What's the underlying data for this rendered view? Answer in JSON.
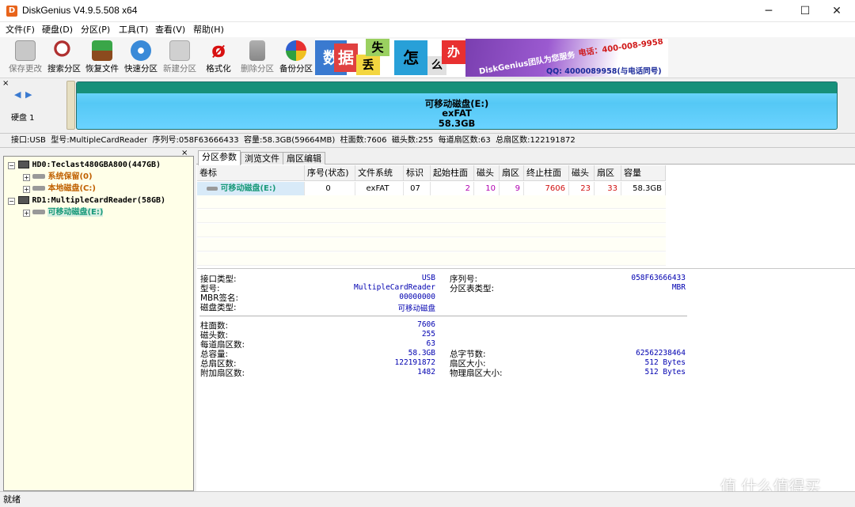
{
  "window": {
    "title": "DiskGenius V4.9.5.508 x64",
    "icon_letter": "D",
    "minimize": "─",
    "maximize": "☐",
    "close": "✕"
  },
  "menu": [
    "文件(F)",
    "硬盘(D)",
    "分区(P)",
    "工具(T)",
    "查看(V)",
    "帮助(H)"
  ],
  "toolbar": [
    {
      "label": "保存更改",
      "icon": "save-icon",
      "enabled": false
    },
    {
      "label": "搜索分区",
      "icon": "search-partition-icon",
      "enabled": true
    },
    {
      "label": "恢复文件",
      "icon": "recover-files-icon",
      "enabled": true
    },
    {
      "label": "快速分区",
      "icon": "quick-partition-icon",
      "enabled": true
    },
    {
      "label": "新建分区",
      "icon": "new-partition-icon",
      "enabled": false
    },
    {
      "label": "格式化",
      "icon": "format-icon",
      "enabled": true
    },
    {
      "label": "删除分区",
      "icon": "delete-partition-icon",
      "enabled": false
    },
    {
      "label": "备份分区",
      "icon": "backup-partition-icon",
      "enabled": true
    }
  ],
  "banner": {
    "chars": [
      "数",
      "据",
      "丢",
      "失",
      "怎",
      "么",
      "办"
    ],
    "slogan": "DiskGenius团队为您服务",
    "phone": "电话：400-008-9958",
    "qq": "QQ: 4000089958(与电话同号)"
  },
  "disk_map": {
    "nav_left": "◀",
    "nav_right": "▶",
    "disk_label": "硬盘 1",
    "partition_name": "可移动磁盘(E:)",
    "filesystem": "exFAT",
    "size": "58.3GB",
    "close": "×"
  },
  "disk_info": "接口:USB  型号:MultipleCardReader  序列号:058F63666433  容量:58.3GB(59664MB)  柱面数:7606  磁头数:255  每道扇区数:63  总扇区数:122191872",
  "tree": [
    {
      "label": "HD0:Teclast480GBA800(447GB)",
      "level": 0,
      "color": "#000"
    },
    {
      "label": "系统保留(0)",
      "level": 1,
      "color": "#c06000"
    },
    {
      "label": "本地磁盘(C:)",
      "level": 1,
      "color": "#c06000"
    },
    {
      "label": "RD1:MultipleCardReader(58GB)",
      "level": 0,
      "color": "#000"
    },
    {
      "label": "可移动磁盘(E:)",
      "level": 1,
      "color": "#1a9a7a",
      "selected": true
    }
  ],
  "tabs": [
    "分区参数",
    "浏览文件",
    "扇区编辑"
  ],
  "table": {
    "headers": [
      "卷标",
      "序号(状态)",
      "文件系统",
      "标识",
      "起始柱面",
      "磁头",
      "扇区",
      "终止柱面",
      "磁头",
      "扇区",
      "容量"
    ],
    "row": [
      "可移动磁盘(E:)",
      "0",
      "exFAT",
      "07",
      "2",
      "10",
      "9",
      "7606",
      "23",
      "33",
      "58.3GB"
    ]
  },
  "details_left": [
    {
      "k": "接口类型:",
      "v": "USB"
    },
    {
      "k": "型号:",
      "v": "MultipleCardReader"
    },
    {
      "k": "MBR签名:",
      "v": "00000000"
    },
    {
      "k": "磁盘类型:",
      "v": "可移动磁盘"
    }
  ],
  "details_right": [
    {
      "k": "序列号:",
      "v": "058F63666433"
    },
    {
      "k": "分区表类型:",
      "v": "MBR"
    }
  ],
  "geometry_left": [
    {
      "k": "柱面数:",
      "v": "7606"
    },
    {
      "k": "磁头数:",
      "v": "255"
    },
    {
      "k": "每道扇区数:",
      "v": "63"
    },
    {
      "k": "总容量:",
      "v": "58.3GB"
    },
    {
      "k": "总扇区数:",
      "v": "122191872"
    },
    {
      "k": "附加扇区数:",
      "v": "1482"
    }
  ],
  "geometry_right": [
    {
      "k": "总字节数:",
      "v": "62562238464"
    },
    {
      "k": "扇区大小:",
      "v": "512 Bytes"
    },
    {
      "k": "物理扇区大小:",
      "v": "512 Bytes"
    }
  ],
  "status": "就绪",
  "watermark": "值 什么值得买"
}
